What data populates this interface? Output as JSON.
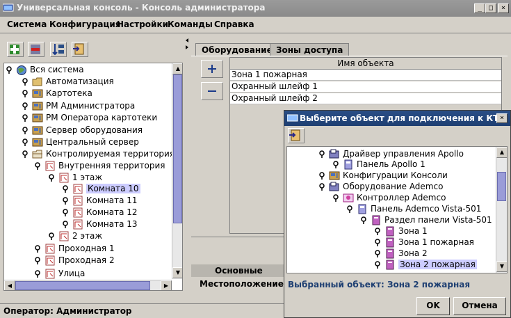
{
  "window": {
    "title": "Универсальная консоль - Консоль администратора"
  },
  "menu": {
    "items": [
      "Система",
      "Конфигурация",
      "Настройки",
      "Команды",
      "Справка"
    ]
  },
  "toolbar": {
    "buttons": [
      "add-icon",
      "remove-icon",
      "move-icon",
      "connect-icon"
    ]
  },
  "tree": {
    "items": [
      {
        "label": "Вся система"
      },
      {
        "label": "Автоматизация"
      },
      {
        "label": "Картотека"
      },
      {
        "label": "РМ Администратора"
      },
      {
        "label": "РМ Оператора картотеки"
      },
      {
        "label": "Сервер оборудования"
      },
      {
        "label": "Центральный сервер"
      },
      {
        "label": "Контролируемая территория"
      },
      {
        "label": "Внутренняя территория"
      },
      {
        "label": "1 этаж"
      },
      {
        "label": "Комната 10"
      },
      {
        "label": "Комната 11"
      },
      {
        "label": "Комната 12"
      },
      {
        "label": "Комната 13"
      },
      {
        "label": "2 этаж"
      },
      {
        "label": "Проходная 1"
      },
      {
        "label": "Проходная 2"
      },
      {
        "label": "Улица"
      }
    ],
    "selected": "Комната 10"
  },
  "tabs": {
    "equipment": "Оборудование",
    "access_zones": "Зоны доступа"
  },
  "table": {
    "header": "Имя объекта",
    "rows": [
      "Зона 1 пожарная",
      "Охранный шлейф 1",
      "Охранный шлейф 2"
    ]
  },
  "bottom_tabs": {
    "main": "Основные",
    "location": "Местоположение лю"
  },
  "status": {
    "operator": "Оператор: Администратор"
  },
  "dialog": {
    "title": "Выберите объект для подключения к КТ",
    "tree": [
      {
        "label": "Драйвер управления Apollo"
      },
      {
        "label": "Панель Apollo 1"
      },
      {
        "label": "Конфигурации Консоли"
      },
      {
        "label": "Оборудование Ademco"
      },
      {
        "label": "Контроллер Ademco"
      },
      {
        "label": "Панель Ademco Vista-501"
      },
      {
        "label": "Раздел панели Vista-501"
      },
      {
        "label": "Зона 1"
      },
      {
        "label": "Зона 1 пожарная"
      },
      {
        "label": "Зона 2"
      },
      {
        "label": "Зона 2 пожарная"
      }
    ],
    "selected_label": "Выбранный объект: Зона 2 пожарная",
    "ok": "OK",
    "cancel": "Отмена"
  },
  "colors": {
    "selection": "#ccccff",
    "dialog_title": "#1e3f72",
    "selected_text": "#1e3f72",
    "scroll_thumb": "#9a9cd8"
  }
}
